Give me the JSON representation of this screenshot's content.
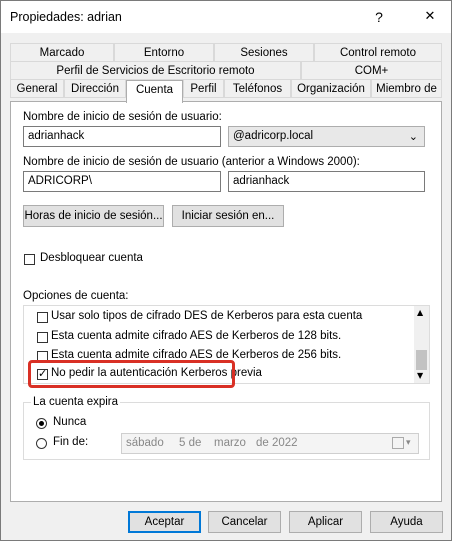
{
  "window": {
    "title": "Propiedades: adrian",
    "help": "?",
    "close": "✕"
  },
  "tabs": {
    "row1": [
      "Marcado",
      "Entorno",
      "Sesiones",
      "Control remoto"
    ],
    "row2": [
      "Perfil de Servicios de Escritorio remoto",
      "COM+"
    ],
    "row3": [
      "General",
      "Dirección",
      "Cuenta",
      "Perfil",
      "Teléfonos",
      "Organización",
      "Miembro de"
    ],
    "active": "Cuenta"
  },
  "account": {
    "logon_label": "Nombre de inicio de sesión de usuario:",
    "logon_value": "adrianhack",
    "domain_value": "@adricorp.local",
    "pre2000_label": "Nombre de inicio de sesión de usuario (anterior a Windows 2000):",
    "pre2000_domain": "ADRICORP\\",
    "pre2000_user": "adrianhack",
    "logon_hours_button": "Horas de inicio de sesión...",
    "logon_to_button": "Iniciar sesión en...",
    "unlock_label": "Desbloquear cuenta",
    "options_label": "Opciones de cuenta:",
    "options": [
      {
        "label": "Usar solo tipos de cifrado DES de Kerberos para esta cuenta",
        "checked": false
      },
      {
        "label": "Esta cuenta admite cifrado AES de Kerberos de 128 bits.",
        "checked": false
      },
      {
        "label": "Esta cuenta admite cifrado AES de Kerberos de 256 bits.",
        "checked": false
      },
      {
        "label": "No pedir la autenticación Kerberos previa",
        "checked": true
      }
    ],
    "highlight_color": "#d93025"
  },
  "expires": {
    "label": "La cuenta expira",
    "never": "Nunca",
    "end_of": "Fin de:",
    "date": {
      "day_name": "sábado",
      "day": "5 de",
      "month": "marzo",
      "year": "de 2022"
    }
  },
  "buttons": {
    "ok": "Aceptar",
    "cancel": "Cancelar",
    "apply": "Aplicar",
    "help": "Ayuda"
  }
}
